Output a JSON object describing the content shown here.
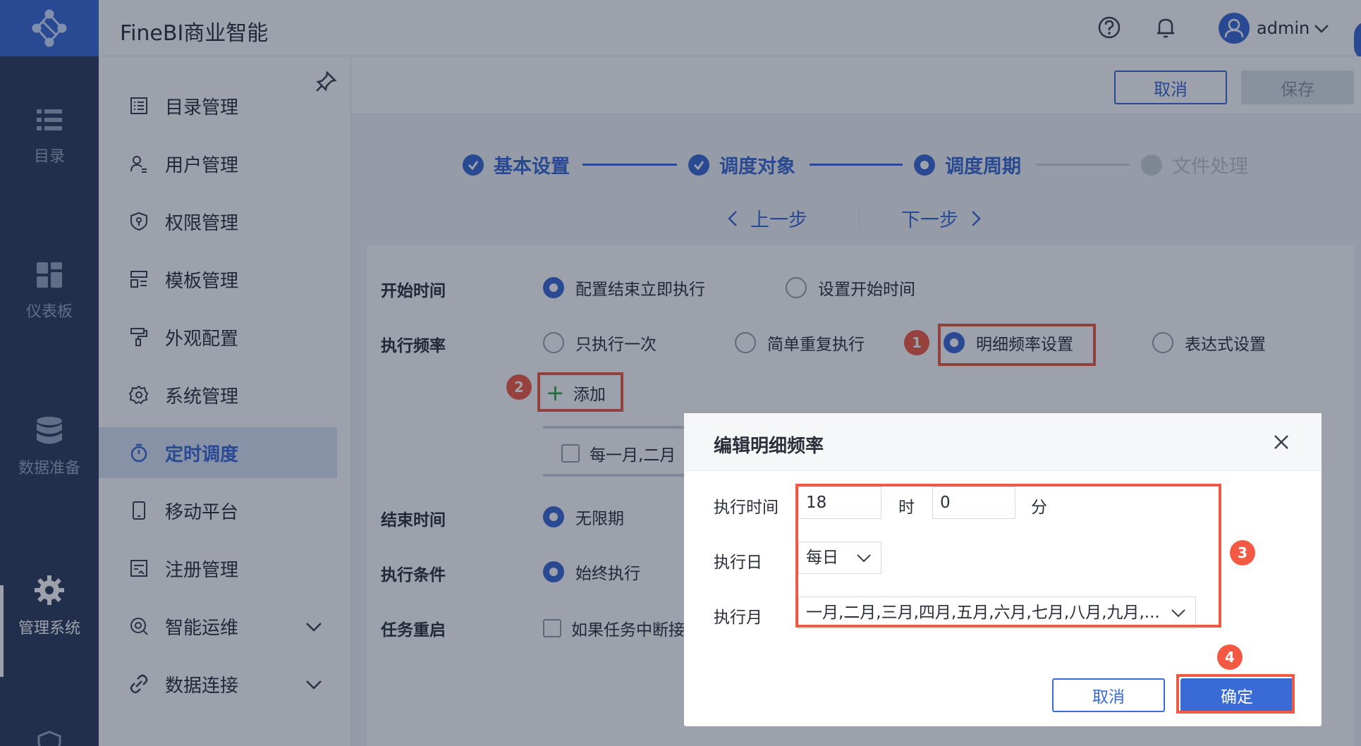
{
  "app": {
    "title": "FineBI商业智能",
    "user": "admin"
  },
  "rail": {
    "items": [
      {
        "label": "目录",
        "icon": "list-icon"
      },
      {
        "label": "仪表板",
        "icon": "dashboard-icon"
      },
      {
        "label": "数据准备",
        "icon": "database-icon"
      },
      {
        "label": "管理系统",
        "icon": "gear-icon"
      }
    ],
    "active": "管理系统"
  },
  "subnav": {
    "items": [
      {
        "label": "目录管理",
        "icon": "catalog-icon"
      },
      {
        "label": "用户管理",
        "icon": "user-icon"
      },
      {
        "label": "权限管理",
        "icon": "shield-icon"
      },
      {
        "label": "模板管理",
        "icon": "template-icon"
      },
      {
        "label": "外观配置",
        "icon": "paint-icon"
      },
      {
        "label": "系统管理",
        "icon": "gear-icon"
      },
      {
        "label": "定时调度",
        "icon": "timer-icon"
      },
      {
        "label": "移动平台",
        "icon": "mobile-icon"
      },
      {
        "label": "注册管理",
        "icon": "register-icon"
      },
      {
        "label": "智能运维",
        "icon": "ops-icon"
      },
      {
        "label": "数据连接",
        "icon": "link-icon"
      }
    ],
    "active": "定时调度"
  },
  "toolbar": {
    "cancel": "取消",
    "save": "保存"
  },
  "stepper": {
    "steps": [
      {
        "label": "基本设置",
        "status": "done"
      },
      {
        "label": "调度对象",
        "status": "done"
      },
      {
        "label": "调度周期",
        "status": "current"
      },
      {
        "label": "文件处理",
        "status": "todo"
      }
    ],
    "prev": "上一步",
    "next": "下一步"
  },
  "form": {
    "start_time": {
      "label": "开始时间",
      "options": [
        "配置结束立即执行",
        "设置开始时间"
      ],
      "selected": "配置结束立即执行"
    },
    "frequency": {
      "label": "执行频率",
      "options": [
        "只执行一次",
        "简单重复执行",
        "明细频率设置",
        "表达式设置"
      ],
      "selected": "明细频率设置"
    },
    "add": "添加",
    "schedule_item": "每一月,二月",
    "end_time": {
      "label": "结束时间",
      "option": "无限期"
    },
    "condition": {
      "label": "执行条件",
      "option": "始终执行"
    },
    "restart": {
      "label": "任务重启",
      "option": "如果任务中断接"
    }
  },
  "badges": [
    "1",
    "2",
    "3",
    "4"
  ],
  "modal": {
    "title": "编辑明细频率",
    "exec_time_label": "执行时间",
    "hour": "18",
    "hour_unit": "时",
    "minute": "0",
    "minute_unit": "分",
    "exec_day_label": "执行日",
    "exec_day": "每日",
    "exec_month_label": "执行月",
    "exec_month": "一月,二月,三月,四月,五月,六月,七月,八月,九月,...",
    "cancel": "取消",
    "confirm": "确定"
  },
  "colors": {
    "brand": "#3a6ad6",
    "rail": "#2d3b5c",
    "highlight": "#ef5a45",
    "badge": "#f45a43"
  }
}
